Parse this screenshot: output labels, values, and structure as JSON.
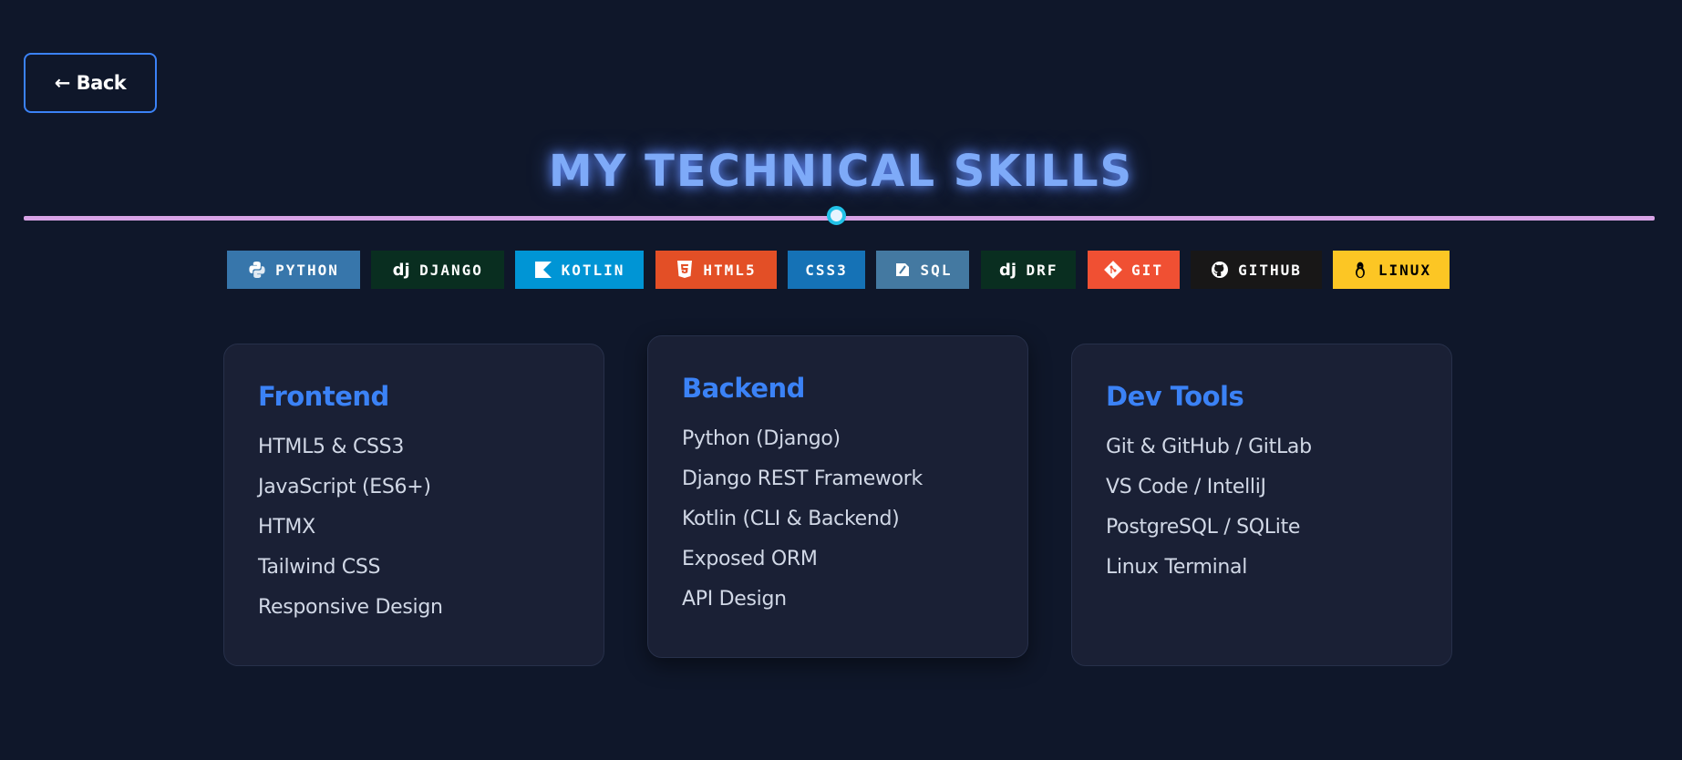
{
  "back": {
    "label": "← Back"
  },
  "title": "MY TECHNICAL SKILLS",
  "badges": [
    {
      "label": "PYTHON",
      "icon": "python-icon",
      "color": "#3776ab",
      "glyph": "🐍"
    },
    {
      "label": "DJANGO",
      "icon": "django-icon",
      "color": "#092e20",
      "glyph": "dj"
    },
    {
      "label": "KOTLIN",
      "icon": "kotlin-icon",
      "color": "#0095d5",
      "glyph": "◣"
    },
    {
      "label": "HTML5",
      "icon": "html5-icon",
      "color": "#e34f26",
      "glyph": "5"
    },
    {
      "label": "CSS3",
      "icon": "",
      "color": "#1572b6",
      "glyph": ""
    },
    {
      "label": "SQL",
      "icon": "sql-icon",
      "color": "#4479a1",
      "glyph": "✎"
    },
    {
      "label": "DRF",
      "icon": "django-icon",
      "color": "#092e20",
      "glyph": "dj"
    },
    {
      "label": "GIT",
      "icon": "git-icon",
      "color": "#f05033",
      "glyph": "◆"
    },
    {
      "label": "GITHUB",
      "icon": "github-icon",
      "color": "#181717",
      "glyph": "●"
    },
    {
      "label": "LINUX",
      "icon": "linux-icon",
      "color": "#fcc624",
      "glyph": "🐧"
    }
  ],
  "cards": [
    {
      "title": "Frontend",
      "items": [
        "HTML5 & CSS3",
        "JavaScript (ES6+)",
        "HTMX",
        "Tailwind CSS",
        "Responsive Design"
      ]
    },
    {
      "title": "Backend",
      "items": [
        "Python (Django)",
        "Django REST Framework",
        "Kotlin (CLI & Backend)",
        "Exposed ORM",
        "API Design"
      ]
    },
    {
      "title": "Dev Tools",
      "items": [
        "Git & GitHub / GitLab",
        "VS Code / IntelliJ",
        "PostgreSQL / SQLite",
        "Linux Terminal"
      ]
    }
  ],
  "colors": {
    "background": "#0f172a",
    "accent": "#3b82f6",
    "title_glow": "#7eaaf8",
    "divider": "#d8a3e6",
    "card": "#1a2035"
  }
}
